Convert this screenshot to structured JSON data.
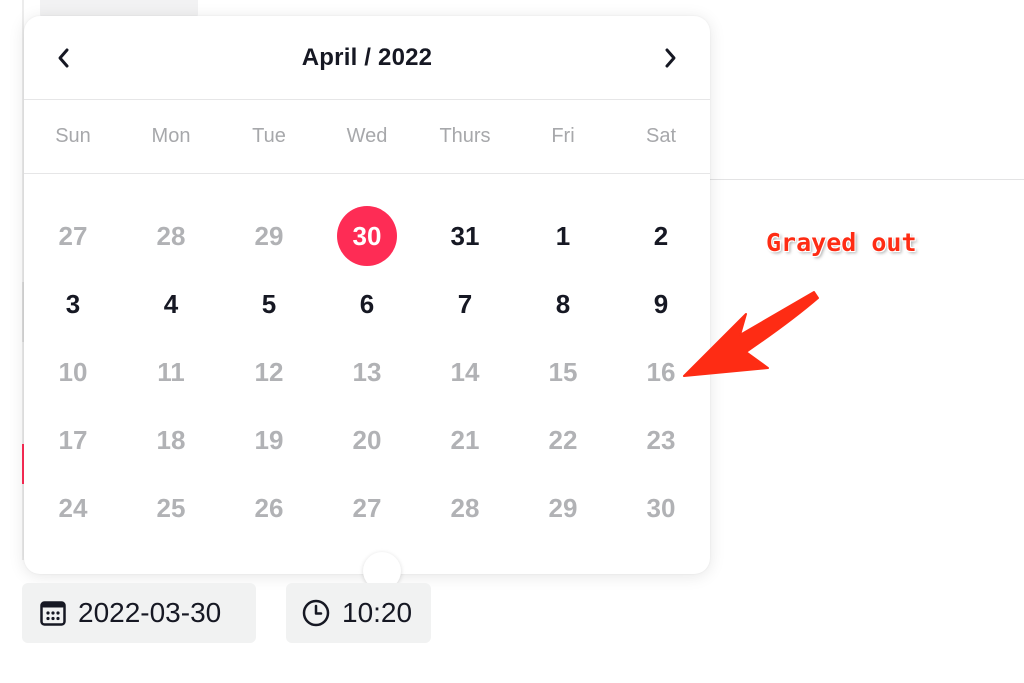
{
  "calendar": {
    "title": "April / 2022",
    "prev_label": "previous month",
    "next_label": "next month",
    "weekdays": [
      "Sun",
      "Mon",
      "Tue",
      "Wed",
      "Thurs",
      "Fri",
      "Sat"
    ],
    "selected_day": "30",
    "weeks": [
      [
        {
          "label": "27",
          "state": "disabled"
        },
        {
          "label": "28",
          "state": "disabled"
        },
        {
          "label": "29",
          "state": "disabled"
        },
        {
          "label": "30",
          "state": "selected"
        },
        {
          "label": "31",
          "state": "enabled"
        },
        {
          "label": "1",
          "state": "enabled"
        },
        {
          "label": "2",
          "state": "enabled"
        }
      ],
      [
        {
          "label": "3",
          "state": "enabled"
        },
        {
          "label": "4",
          "state": "enabled"
        },
        {
          "label": "5",
          "state": "enabled"
        },
        {
          "label": "6",
          "state": "enabled"
        },
        {
          "label": "7",
          "state": "enabled"
        },
        {
          "label": "8",
          "state": "enabled"
        },
        {
          "label": "9",
          "state": "enabled"
        }
      ],
      [
        {
          "label": "10",
          "state": "disabled"
        },
        {
          "label": "11",
          "state": "disabled"
        },
        {
          "label": "12",
          "state": "disabled"
        },
        {
          "label": "13",
          "state": "disabled"
        },
        {
          "label": "14",
          "state": "disabled"
        },
        {
          "label": "15",
          "state": "disabled"
        },
        {
          "label": "16",
          "state": "disabled"
        }
      ],
      [
        {
          "label": "17",
          "state": "disabled"
        },
        {
          "label": "18",
          "state": "disabled"
        },
        {
          "label": "19",
          "state": "disabled"
        },
        {
          "label": "20",
          "state": "disabled"
        },
        {
          "label": "21",
          "state": "disabled"
        },
        {
          "label": "22",
          "state": "disabled"
        },
        {
          "label": "23",
          "state": "disabled"
        }
      ],
      [
        {
          "label": "24",
          "state": "disabled"
        },
        {
          "label": "25",
          "state": "disabled"
        },
        {
          "label": "26",
          "state": "disabled"
        },
        {
          "label": "27",
          "state": "disabled"
        },
        {
          "label": "28",
          "state": "disabled"
        },
        {
          "label": "29",
          "state": "disabled"
        },
        {
          "label": "30",
          "state": "disabled"
        }
      ]
    ]
  },
  "schedule": {
    "date_value": "2022-03-30",
    "date_icon": "calendar-icon",
    "time_value": "10:20",
    "time_icon": "clock-icon"
  },
  "annotation": {
    "text": "Grayed out",
    "icon": "arrow-icon"
  },
  "colors": {
    "accent": "#fe2c55",
    "toggle_on": "#20d5a0",
    "annotation": "#fe2c14",
    "text_primary": "#161823",
    "text_disabled": "#b1b2b5"
  }
}
